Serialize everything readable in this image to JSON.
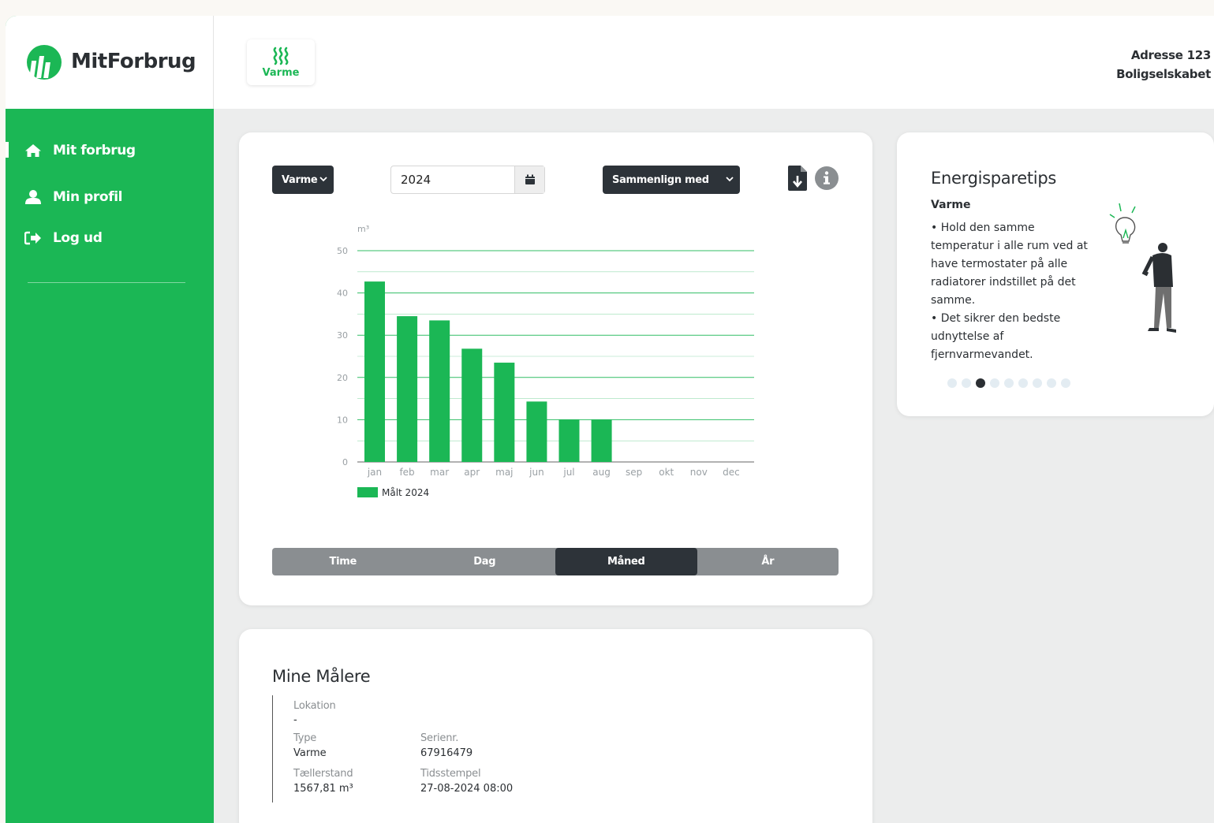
{
  "app": {
    "name": "MitForbrug"
  },
  "sidebar": {
    "items": [
      {
        "label": "Mit forbrug",
        "icon": "home-icon",
        "active": true
      },
      {
        "label": "Min profil",
        "icon": "user-icon",
        "active": false
      },
      {
        "label": "Log ud",
        "icon": "logout-icon",
        "active": false
      }
    ]
  },
  "topbar": {
    "utility_tab": {
      "label": "Varme",
      "icon": "heat-icon"
    },
    "address": "Adresse 123",
    "company": "Boligselskabet"
  },
  "controls": {
    "utility_select": "Varme",
    "year_value": "2024",
    "compare_select": "Sammenlign med"
  },
  "chart_data": {
    "type": "bar",
    "unit_label": "m³",
    "categories": [
      "jan",
      "feb",
      "mar",
      "apr",
      "maj",
      "jun",
      "jul",
      "aug",
      "sep",
      "okt",
      "nov",
      "dec"
    ],
    "series": [
      {
        "name": "Målt 2024",
        "values": [
          42.7,
          34.5,
          33.5,
          26.8,
          23.5,
          14.3,
          10,
          10,
          0,
          0,
          0,
          0
        ]
      }
    ],
    "ylim": [
      0,
      50
    ],
    "yticks": [
      0,
      10,
      20,
      30,
      40,
      50
    ],
    "grid": true,
    "legend": "bottom-left",
    "colors": {
      "bar": "#1bb755",
      "grid": "#1bb755",
      "axis_text": "#9aa0a4"
    }
  },
  "period_tabs": [
    {
      "label": "Time",
      "active": false
    },
    {
      "label": "Dag",
      "active": false
    },
    {
      "label": "Måned",
      "active": true
    },
    {
      "label": "År",
      "active": false
    }
  ],
  "tips": {
    "title": "Energisparetips",
    "subtitle": "Varme",
    "lines": [
      "• Hold den samme temperatur i alle rum ved at have termostater på alle radiatorer indstillet på det samme.",
      "• Det sikrer den bedste udnyttelse af fjernvarmevandet."
    ],
    "dots_total": 9,
    "dot_active": 2
  },
  "meters": {
    "title": "Mine Målere",
    "location_label": "Lokation",
    "location_value": "-",
    "type_label": "Type",
    "type_value": "Varme",
    "serial_label": "Serienr.",
    "serial_value": "67916479",
    "reading_label": "Tællerstand",
    "reading_value": "1567,81 m³",
    "timestamp_label": "Tidsstempel",
    "timestamp_value": "27-08-2024 08:00"
  },
  "colors": {
    "brand_green": "#1bb755",
    "dark": "#2d3339",
    "bg": "#eceded"
  }
}
